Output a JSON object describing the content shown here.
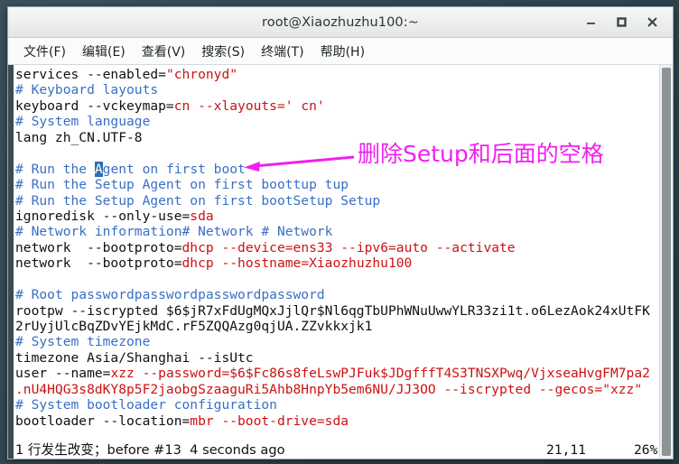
{
  "window": {
    "title": "root@Xiaozhuzhu100:~",
    "controls": [
      {
        "name": "minimize-button",
        "glyph": "–"
      },
      {
        "name": "maximize-button",
        "glyph": "□"
      },
      {
        "name": "close-button",
        "glyph": "✕"
      }
    ]
  },
  "menubar": {
    "items": [
      {
        "label": "文件(F)"
      },
      {
        "label": "编辑(E)"
      },
      {
        "label": "查看(V)"
      },
      {
        "label": "搜索(S)"
      },
      {
        "label": "终端(T)"
      },
      {
        "label": "帮助(H)"
      }
    ]
  },
  "terminal": {
    "lines": [
      {
        "type": "code",
        "segments": [
          {
            "t": "services --enabled=",
            "c": "plain"
          },
          {
            "t": "\"chronyd\"",
            "c": "val"
          }
        ]
      },
      {
        "type": "code",
        "segments": [
          {
            "t": "# Keyboard layouts",
            "c": "cmt"
          }
        ]
      },
      {
        "type": "code",
        "segments": [
          {
            "t": "keyboard --vckeymap=",
            "c": "plain"
          },
          {
            "t": "cn",
            "c": "val"
          },
          {
            "t": " --xlayouts=",
            "c": "val"
          },
          {
            "t": "' cn'",
            "c": "val"
          }
        ]
      },
      {
        "type": "code",
        "segments": [
          {
            "t": "# System language",
            "c": "cmt"
          }
        ]
      },
      {
        "type": "code",
        "segments": [
          {
            "t": "lang zh_CN.UTF-8",
            "c": "plain"
          }
        ]
      },
      {
        "type": "blank",
        "segments": []
      },
      {
        "type": "code",
        "segments": [
          {
            "t": "# Run the ",
            "c": "cmt"
          },
          {
            "t": "A",
            "c": "cursor"
          },
          {
            "t": "gent on first boot",
            "c": "cmt"
          }
        ]
      },
      {
        "type": "code",
        "segments": [
          {
            "t": "# Run the Setup Agent on first boottup tup",
            "c": "cmt"
          }
        ]
      },
      {
        "type": "code",
        "segments": [
          {
            "t": "# Run the Setup Agent on first bootSetup Setup",
            "c": "cmt"
          }
        ]
      },
      {
        "type": "code",
        "segments": [
          {
            "t": "ignoredisk --only-use=",
            "c": "plain"
          },
          {
            "t": "sda",
            "c": "val"
          }
        ]
      },
      {
        "type": "code",
        "segments": [
          {
            "t": "# Network information# Network # Network",
            "c": "cmt"
          }
        ]
      },
      {
        "type": "code",
        "segments": [
          {
            "t": "network  --bootproto=",
            "c": "plain"
          },
          {
            "t": "dhcp",
            "c": "val"
          },
          {
            "t": " --device=",
            "c": "val"
          },
          {
            "t": "ens33",
            "c": "val"
          },
          {
            "t": " --ipv6=",
            "c": "val"
          },
          {
            "t": "auto",
            "c": "val"
          },
          {
            "t": " --activate",
            "c": "val"
          }
        ]
      },
      {
        "type": "code",
        "segments": [
          {
            "t": "network  --bootproto=",
            "c": "plain"
          },
          {
            "t": "dhcp",
            "c": "val"
          },
          {
            "t": " --hostname=",
            "c": "val"
          },
          {
            "t": "Xiaozhuzhu100",
            "c": "val"
          }
        ]
      },
      {
        "type": "blank",
        "segments": []
      },
      {
        "type": "code",
        "segments": [
          {
            "t": "# Root passwordpasswordpasswordpassword",
            "c": "cmt"
          }
        ]
      },
      {
        "type": "code",
        "segments": [
          {
            "t": "rootpw --iscrypted $6$jR7xFdUgMQxJjlQr$Nl6qgTbUPhWNuUwwYLR33zi1t.o6LezAok24xUtFK",
            "c": "plain"
          }
        ]
      },
      {
        "type": "code",
        "segments": [
          {
            "t": "2rUyjUlcBqZDvYEjkMdC.rF5ZQQAzg0qjUA.ZZvkkxjk1",
            "c": "plain"
          }
        ]
      },
      {
        "type": "code",
        "segments": [
          {
            "t": "# System timezone",
            "c": "cmt"
          }
        ]
      },
      {
        "type": "code",
        "segments": [
          {
            "t": "timezone Asia/Shanghai --isUtc",
            "c": "plain"
          }
        ]
      },
      {
        "type": "code",
        "segments": [
          {
            "t": "user --name=",
            "c": "plain"
          },
          {
            "t": "xzz",
            "c": "val"
          },
          {
            "t": " --password=",
            "c": "val"
          },
          {
            "t": "$6$Fc86s8feLswPJFuk$JDgfffT4S3TNSXPwq/VjxseaHvgFM7pa2",
            "c": "val"
          }
        ]
      },
      {
        "type": "code",
        "segments": [
          {
            "t": ".nU4HQG3s8dKY8p5F2jaobgSzaaguRi5Ahb8HnpYb5em6NU/JJ3OO",
            "c": "val"
          },
          {
            "t": " --iscrypted",
            "c": "val"
          },
          {
            "t": " --gecos=",
            "c": "val"
          },
          {
            "t": "\"xzz\"",
            "c": "val"
          }
        ]
      },
      {
        "type": "code",
        "segments": [
          {
            "t": "# System bootloader configuration",
            "c": "cmt"
          }
        ]
      },
      {
        "type": "code",
        "segments": [
          {
            "t": "bootloader --location=",
            "c": "plain"
          },
          {
            "t": "mbr",
            "c": "val"
          },
          {
            "t": " --boot-drive=",
            "c": "val"
          },
          {
            "t": "sda",
            "c": "val"
          }
        ]
      }
    ],
    "status": {
      "message": "1 行发生改变；before #13  4 seconds ago",
      "position": "21,11",
      "percent": "26%"
    }
  },
  "annotation": {
    "text": "删除Setup和后面的空格",
    "color": "#f11ff1"
  },
  "colors": {
    "comment": "#3a6fc4",
    "value": "#cc1111",
    "cursor_bg": "#2f6fb5",
    "annotation": "#f11ff1",
    "titlebar_bg": "#eceded",
    "desktop_bg": "#2f464f"
  }
}
